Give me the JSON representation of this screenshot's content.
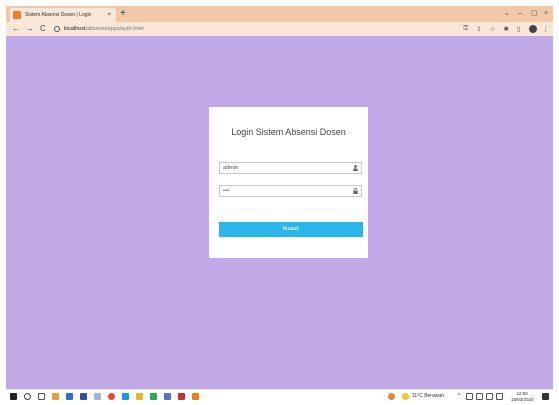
{
  "browser": {
    "tab_title": "Sistem Absensi Dosen | Login",
    "tab_close": "×",
    "new_tab": "+",
    "window_controls": [
      "⌄",
      "–",
      "▢",
      "×"
    ],
    "url_host": "localhost",
    "url_path": "/absensi/apps/auth.html",
    "nav": {
      "back": "←",
      "forward": "→",
      "reload": "C"
    }
  },
  "login": {
    "title": "Login Sistem Absensi Dosen",
    "username_value": "admin",
    "password_value": "•••",
    "submit_label": "Masuk"
  },
  "taskbar": {
    "weather": "11°C Berawan",
    "tray": "^",
    "time": "12:55",
    "date": "18/03/2020"
  },
  "colors": {
    "page_background": "#c0a9e6",
    "button": "#2bb5e8",
    "browser_tab_strip": "#f0c8a8"
  }
}
